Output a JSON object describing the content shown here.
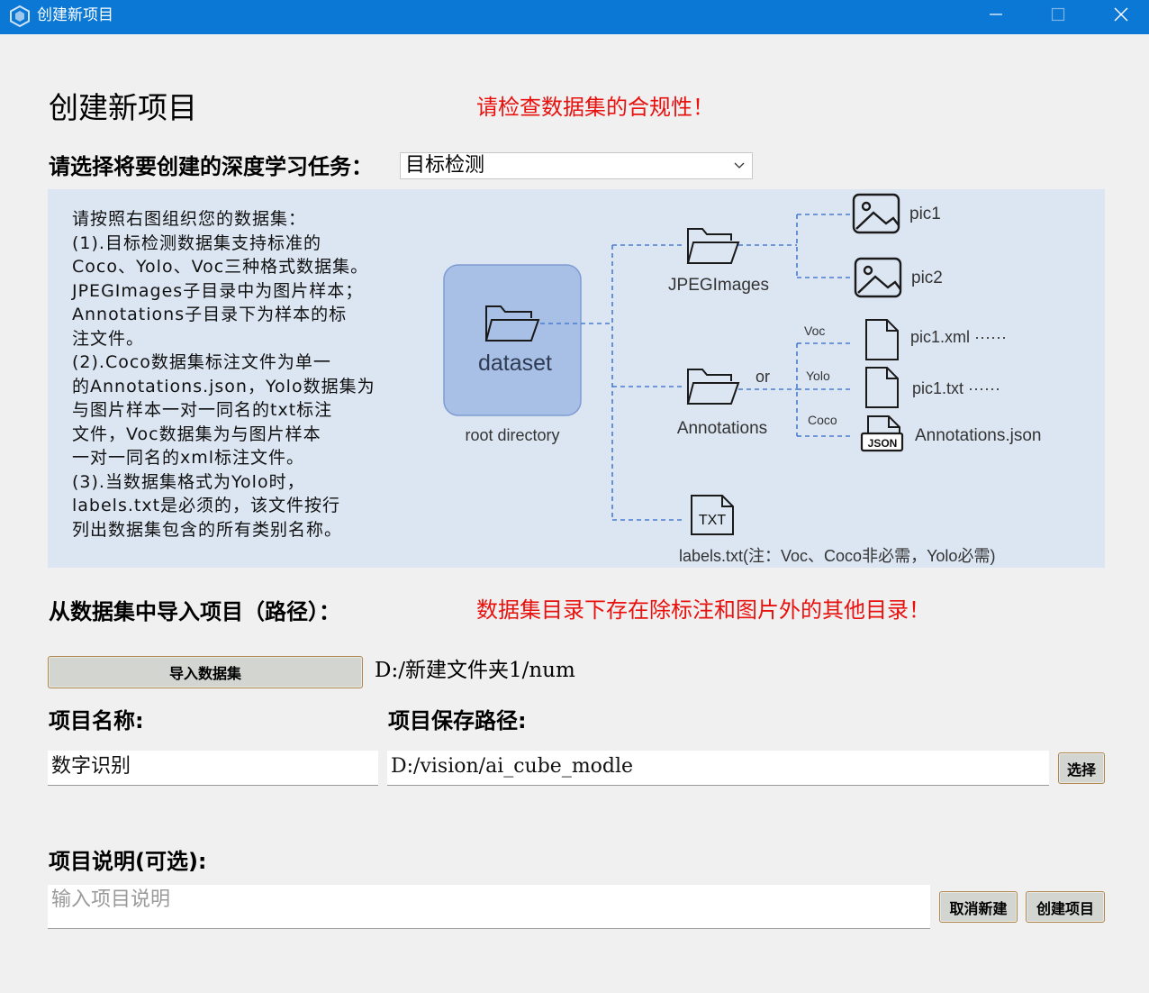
{
  "window": {
    "title": "创建新项目",
    "controls": {
      "minimize": "minimize-icon",
      "maximize": "maximize-icon",
      "close": "close-icon"
    }
  },
  "header": {
    "title": "创建新项目",
    "warning": "请检查数据集的合规性！"
  },
  "task": {
    "label": "请选择将要创建的深度学习任务：",
    "selected": "目标检测"
  },
  "guide": {
    "text": "请按照右图组织您的数据集：\n(1).目标检测数据集支持标准的\nCoco、Yolo、Voc三种格式数据集。\nJPEGImages子目录中为图片样本；\nAnnotations子目录下为样本的标\n注文件。\n(2).Coco数据集标注文件为单一\n的Annotations.json，Yolo数据集为\n与图片样本一对一同名的txt标注\n文件，Voc数据集为与图片样本\n一对一同名的xml标注文件。\n(3).当数据集格式为Yolo时，\nlabels.txt是必须的，该文件按行\n列出数据集包含的所有类别名称。",
    "diagram": {
      "root": "dataset",
      "root_caption": "root directory",
      "jpeg_folder": "JPEGImages",
      "pic1": "pic1",
      "pic2": "pic2",
      "annotations_folder": "Annotations",
      "or": "or",
      "voc": "Voc",
      "yolo": "Yolo",
      "coco": "Coco",
      "xml_file": "pic1.xml ······",
      "txt_file": "pic1.txt  ······",
      "json_file": "Annotations.json",
      "json_badge": "JSON",
      "txt_badge": "TXT",
      "labels_note": "labels.txt(注：Voc、Coco非必需，Yolo必需)"
    }
  },
  "import": {
    "label": "从数据集中导入项目（路径）：",
    "warning": "数据集目录下存在除标注和图片外的其他目录！",
    "button": "导入数据集",
    "path": "D:/新建文件夹1/num"
  },
  "project": {
    "name_label": "项目名称:",
    "name_value": "数字识别",
    "save_label": "项目保存路径:",
    "save_value": "D:/vision/ai_cube_modle",
    "choose_button": "选择"
  },
  "description": {
    "label": "项目说明(可选):",
    "placeholder": "输入项目说明"
  },
  "actions": {
    "cancel": "取消新建",
    "create": "创建项目"
  }
}
